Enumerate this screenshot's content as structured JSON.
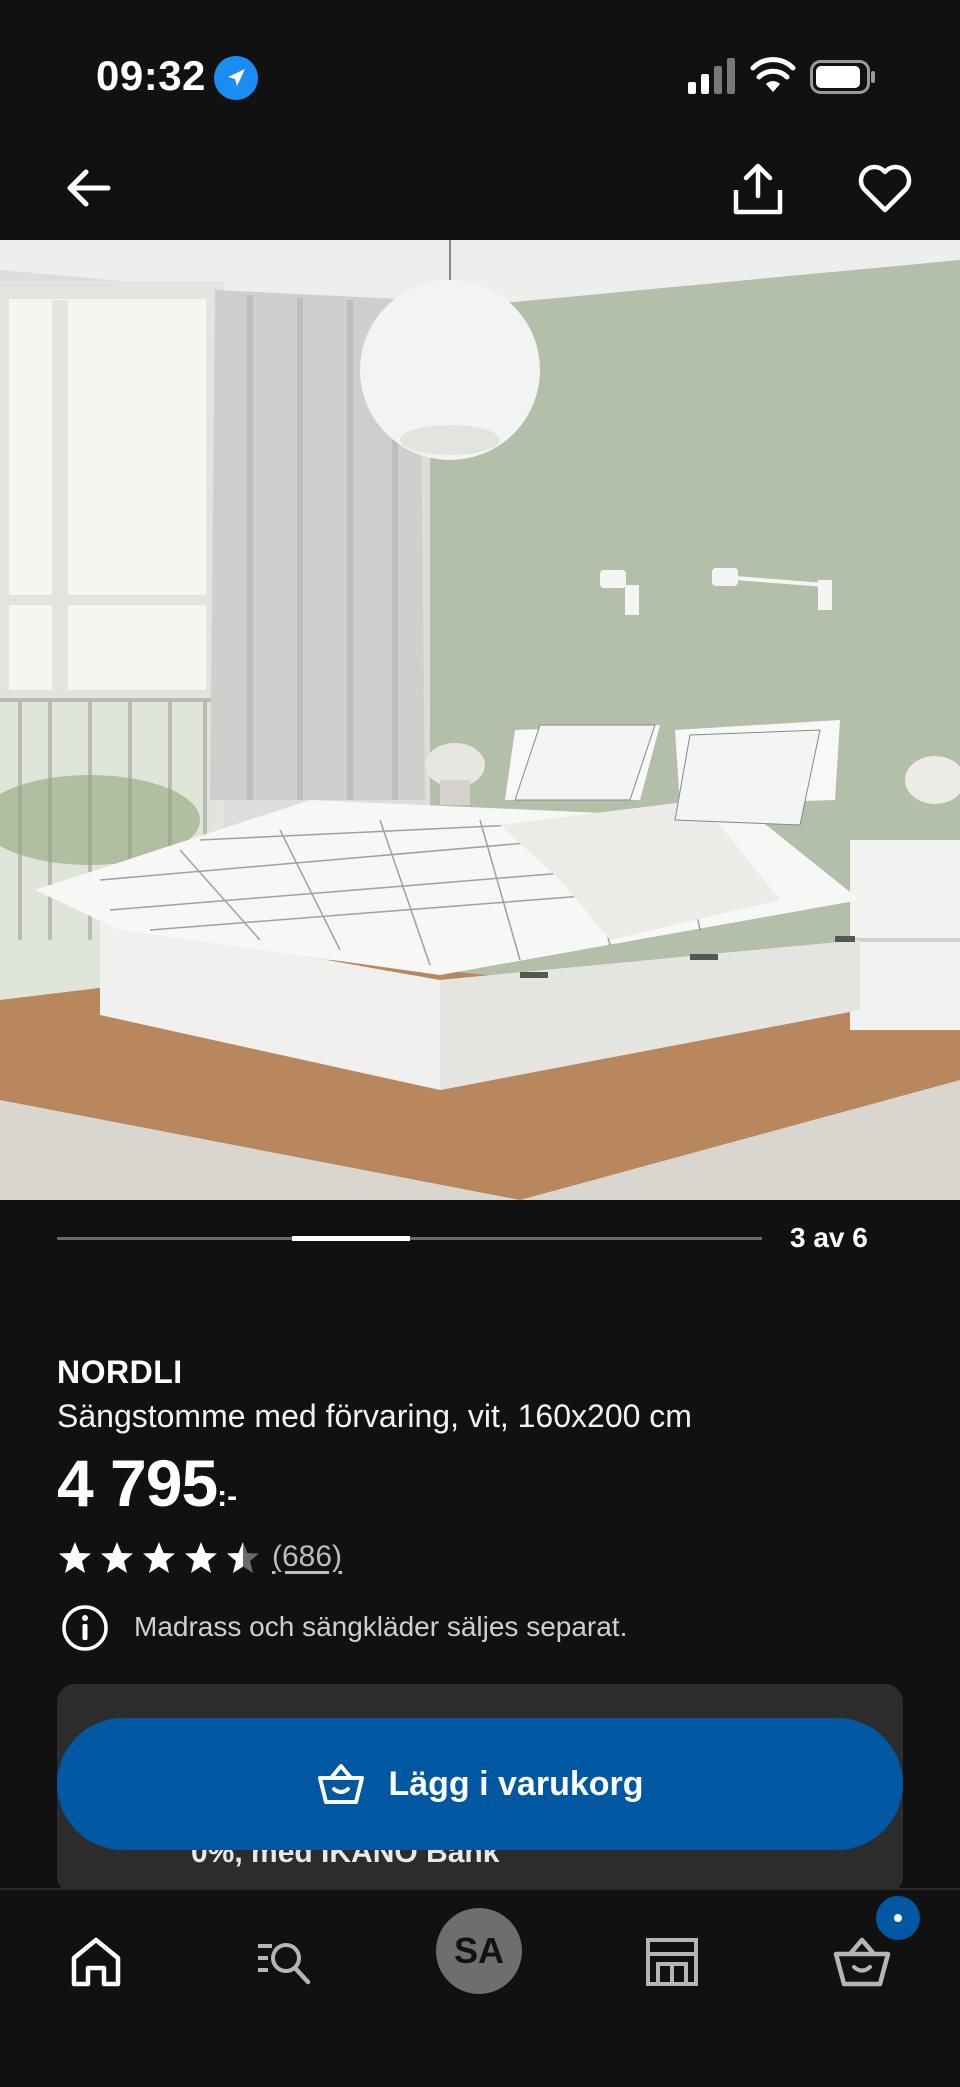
{
  "status_bar": {
    "time": "09:32",
    "icons": [
      "location-arrow-icon",
      "cellular-signal-icon",
      "wifi-icon",
      "battery-icon"
    ]
  },
  "nav": {
    "back_icon": "arrow-left-icon",
    "share_icon": "share-icon",
    "favorite_icon": "heart-icon"
  },
  "gallery": {
    "current": 3,
    "total": 6,
    "counter_text": "3 av 6"
  },
  "product": {
    "brand": "NORDLI",
    "description": "Sängstomme med förvaring, vit, 160x200 cm",
    "price": "4 795",
    "price_suffix": ":-",
    "rating": 4.5,
    "rating_max": 5,
    "review_count": "(686)",
    "notice": "Madrass och sängkläder säljes separat."
  },
  "promo": {
    "partial_text": "0%, med IKANO Bank"
  },
  "cta": {
    "add_to_cart_label": "Lägg i varukorg"
  },
  "tab_bar": {
    "profile_initials": "SA",
    "items": [
      "home-icon",
      "search-list-icon",
      "profile-avatar",
      "store-icon",
      "cart-icon"
    ]
  },
  "colors": {
    "background": "#111111",
    "primary_blue": "#0058a3",
    "location_blue": "#1c8cf5",
    "card": "#2c2c2c"
  }
}
